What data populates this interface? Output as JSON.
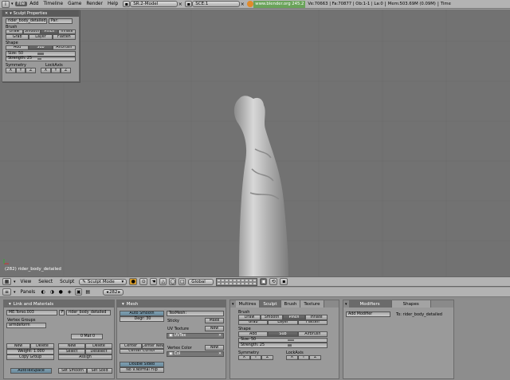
{
  "topbar": {
    "menu": [
      "File",
      "Add",
      "Timeline",
      "Game",
      "Render",
      "Help"
    ],
    "screen": "SR:2-Model",
    "scene": "SCE:1",
    "url": "www.blender.org 245.2",
    "stats": "Ve:70663 | Fa:70877 | Ob:1-1 | La:0",
    "mem": "Mem:503.69M (0.09M)",
    "time": "Time"
  },
  "float": {
    "title": "Sculpt Properties",
    "ob": "rider_body_detailed",
    "par": "Par:",
    "brush_label": "Brush",
    "brushes1": [
      "Draw",
      "Smooth",
      "Pinch",
      "Inflate"
    ],
    "brushes2": [
      "Grab",
      "Layer",
      "Flatten"
    ],
    "shape_label": "Shape",
    "modes": [
      "Add",
      "Sub",
      "Airbrush"
    ],
    "size": "Size: 50",
    "strength": "Strength: 25",
    "sym_label": "Symmetry",
    "lock_label": "LockAxis",
    "xyz": [
      "X",
      "Y",
      "Z"
    ]
  },
  "viewport": {
    "label": "(282) rider_body_detailed"
  },
  "header3d": {
    "menus": [
      "View",
      "Select",
      "Sculpt"
    ],
    "mode": "Sculpt Mode",
    "orient": "Global"
  },
  "buttonshdr": {
    "panels": "Panels",
    "frame": "282"
  },
  "link": {
    "title": "Link and Materials",
    "me": "ME:Torso.003",
    "f": "F",
    "ob": "rider_body_detailed",
    "vg_label": "Vertex Groups",
    "vg": "armdeform",
    "new": "New",
    "del": "Delete",
    "weight": "Weight: 1.000",
    "copy": "Copy Group",
    "mat": "0 Mat 0",
    "mnew": "New",
    "mdel": "Delete",
    "msel": "Select",
    "mdesel": "Deselect",
    "massign": "Assign",
    "autotex": "AutoTexSpace",
    "setsmooth": "Set Smooth",
    "setsolid": "Set Solid"
  },
  "mesh": {
    "title": "Mesh",
    "autosmooth": "Auto Smooth",
    "degr": "Degr: 30",
    "texmesh": "TexMesh:",
    "sticky": "Sticky",
    "make": "Make",
    "uvtex_label": "UV Texture",
    "new": "New",
    "uvtex": "UVTex",
    "centers": [
      "Center",
      "Center New",
      "Center Cursor"
    ],
    "vcol_label": "Vertex Color",
    "vnew": "New",
    "col": "Col",
    "double": "Double Sided",
    "noflip": "No V.Normal Flip"
  },
  "sculpt": {
    "tabs": [
      "Multires",
      "Sculpt",
      "Brush",
      "Texture"
    ],
    "brush_label": "Brush",
    "brushes1": [
      "Draw",
      "Smooth",
      "Pinch",
      "Inflate"
    ],
    "brushes2": [
      "Grab",
      "Layer",
      "Flatten"
    ],
    "shape_label": "Shape",
    "modes": [
      "Add",
      "Sub",
      "Airbrush"
    ],
    "size": "Size: 50",
    "strength": "Strength: 25",
    "sym_label": "Symmetry",
    "lock_label": "LockAxis",
    "xyz": [
      "X",
      "Y",
      "Z"
    ]
  },
  "modifiers": {
    "tabs": [
      "Modifiers",
      "Shapes"
    ],
    "add": "Add Modifier",
    "to": "To: rider_body_detailed"
  },
  "colors": {
    "viewport": "#727272",
    "panel": "#9a9a9a",
    "active": "#5a5a5a"
  }
}
